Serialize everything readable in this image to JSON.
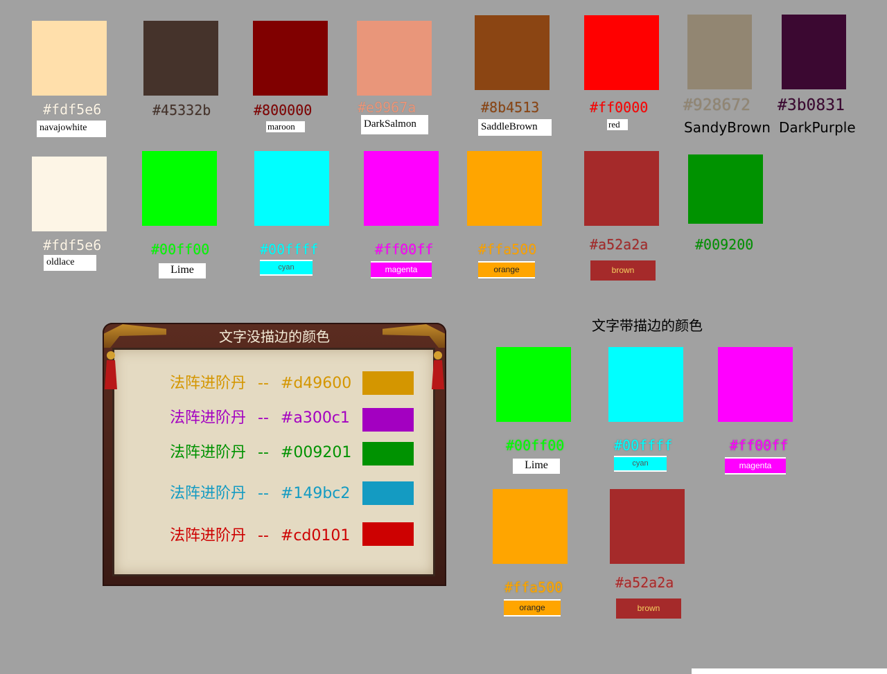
{
  "top_row": [
    {
      "hex": "#fdf5e6",
      "color": "#ffdfab",
      "text_color": "#fdf5e6",
      "name": "navajowhite",
      "name_style": "white"
    },
    {
      "hex": "#45332b",
      "color": "#45332b",
      "text_color": "#45332b",
      "name": "",
      "name_style": "none"
    },
    {
      "hex": "#800000",
      "color": "#800000",
      "text_color": "#800000",
      "name": "maroon",
      "name_style": "white"
    },
    {
      "hex": "#e9967a",
      "color": "#e9967a",
      "text_color": "#e9967a",
      "name": "DarkSalmon",
      "name_style": "white"
    },
    {
      "hex": "#8b4513",
      "color": "#8b4513",
      "text_color": "#8b4513",
      "name": "SaddleBrown",
      "name_style": "white"
    },
    {
      "hex": "#ff0000",
      "color": "#ff0000",
      "text_color": "#ff0000",
      "name": "red",
      "name_style": "white"
    },
    {
      "hex": "#928672",
      "color": "#928672",
      "text_color": "#928672",
      "name": "SandyBrown",
      "name_style": "plain"
    },
    {
      "hex": "#3b0831",
      "color": "#3b0831",
      "text_color": "#3b0831",
      "name": "DarkPurple",
      "name_style": "plain"
    }
  ],
  "second_row": [
    {
      "hex": "#fdf5e6",
      "color": "#fdf5e6",
      "text_color": "#fdf5e6",
      "name": "oldlace",
      "name_style": "white"
    },
    {
      "hex": "#00ff00",
      "color": "#00ff00",
      "text_color": "#00ff00",
      "name": "Lime",
      "name_style": "white"
    },
    {
      "hex": "#00ffff",
      "color": "#00ffff",
      "text_color": "#00ffff",
      "name": "cyan",
      "name_style": "tag"
    },
    {
      "hex": "#ff00ff",
      "color": "#ff00ff",
      "text_color": "#ff00ff",
      "name": "magenta",
      "name_style": "tag"
    },
    {
      "hex": "#ffa500",
      "color": "#ffa500",
      "text_color": "#ffa500",
      "name": "orange",
      "name_style": "tag"
    },
    {
      "hex": "#a52a2a",
      "color": "#a52a2a",
      "text_color": "#a52a2a",
      "name": "brown",
      "name_style": "tag"
    },
    {
      "hex": "#009200",
      "color": "#009200",
      "text_color": "#009200",
      "name": "",
      "name_style": "none"
    }
  ],
  "panel": {
    "title": "文字没描边的颜色",
    "rows": [
      {
        "label": "法阵进阶丹",
        "sep": "--",
        "hex": "#d49600",
        "color": "#d49600"
      },
      {
        "label": "法阵进阶丹",
        "sep": "--",
        "hex": "#a300c1",
        "color": "#a300c1"
      },
      {
        "label": "法阵进阶丹",
        "sep": "--",
        "hex": "#009201",
        "color": "#009201"
      },
      {
        "label": "法阵进阶丹",
        "sep": "--",
        "hex": "#149bc2",
        "color": "#149bc2"
      },
      {
        "label": "法阵进阶丹",
        "sep": "--",
        "hex": "#cd0101",
        "color": "#cd0101"
      }
    ]
  },
  "outlined": {
    "title": "文字带描边的颜色",
    "items": [
      {
        "hex": "#00ff00",
        "color": "#00ff00",
        "name": "Lime",
        "name_style": "white"
      },
      {
        "hex": "#00ffff",
        "color": "#00ffff",
        "name": "cyan",
        "name_style": "tag"
      },
      {
        "hex": "#ff00ff",
        "color": "#ff00ff",
        "name": "magenta",
        "name_style": "tag"
      },
      {
        "hex": "#ffa500",
        "color": "#ffa500",
        "name": "orange",
        "name_style": "tag"
      },
      {
        "hex": "#a52a2a",
        "color": "#a52a2a",
        "name": "brown",
        "name_style": "tag"
      }
    ]
  }
}
